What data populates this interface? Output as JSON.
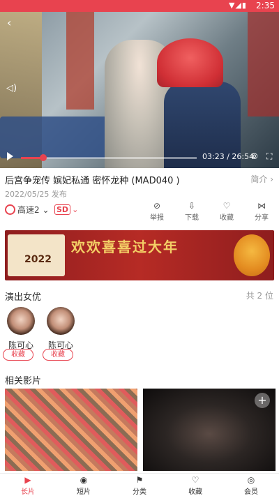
{
  "status_bar": {
    "time": "2:35",
    "icons": "▼◢▮"
  },
  "player": {
    "back_icon": "‹",
    "mute_icon": "◁)",
    "current_time": "03:23",
    "separator": " / ",
    "duration": "26:54",
    "progress_fraction": 0.126,
    "cast_icon": "⦾",
    "fullscreen_icon": "⛶"
  },
  "video": {
    "title": "后宫争宠传 嫔妃私通 密怀龙种 (MAD040 )",
    "intro_label": "简介 ›",
    "date": "2022/05/25 发布"
  },
  "toolbar": {
    "speed_label": "高速2",
    "speed_chevron": "⌄",
    "sd_label": "SD",
    "sd_chevron": "⌄",
    "actions": [
      {
        "icon": "⊘",
        "label": "举报"
      },
      {
        "icon": "⇩",
        "label": "下载"
      },
      {
        "icon": "♡",
        "label": "收藏"
      },
      {
        "icon": "⋈",
        "label": "分享"
      }
    ]
  },
  "banner": {
    "text": "欢欢喜喜过大年",
    "year": "2022"
  },
  "cast": {
    "title": "演出女优",
    "count": "共 2 位",
    "actors": [
      {
        "name": "陈可心",
        "fav_label": "收藏"
      },
      {
        "name": "陈可心",
        "fav_label": "收藏"
      }
    ]
  },
  "related": {
    "title": "相关影片",
    "add_icon": "+"
  },
  "tabbar": {
    "tabs": [
      {
        "icon": "▶",
        "label": "长片",
        "active": true
      },
      {
        "icon": "◉",
        "label": "短片",
        "active": false
      },
      {
        "icon": "⚑",
        "label": "分类",
        "active": false
      },
      {
        "icon": "♡",
        "label": "收藏",
        "active": false
      },
      {
        "icon": "◎",
        "label": "会员",
        "active": false
      }
    ]
  },
  "colors": {
    "accent": "#e8434f"
  }
}
